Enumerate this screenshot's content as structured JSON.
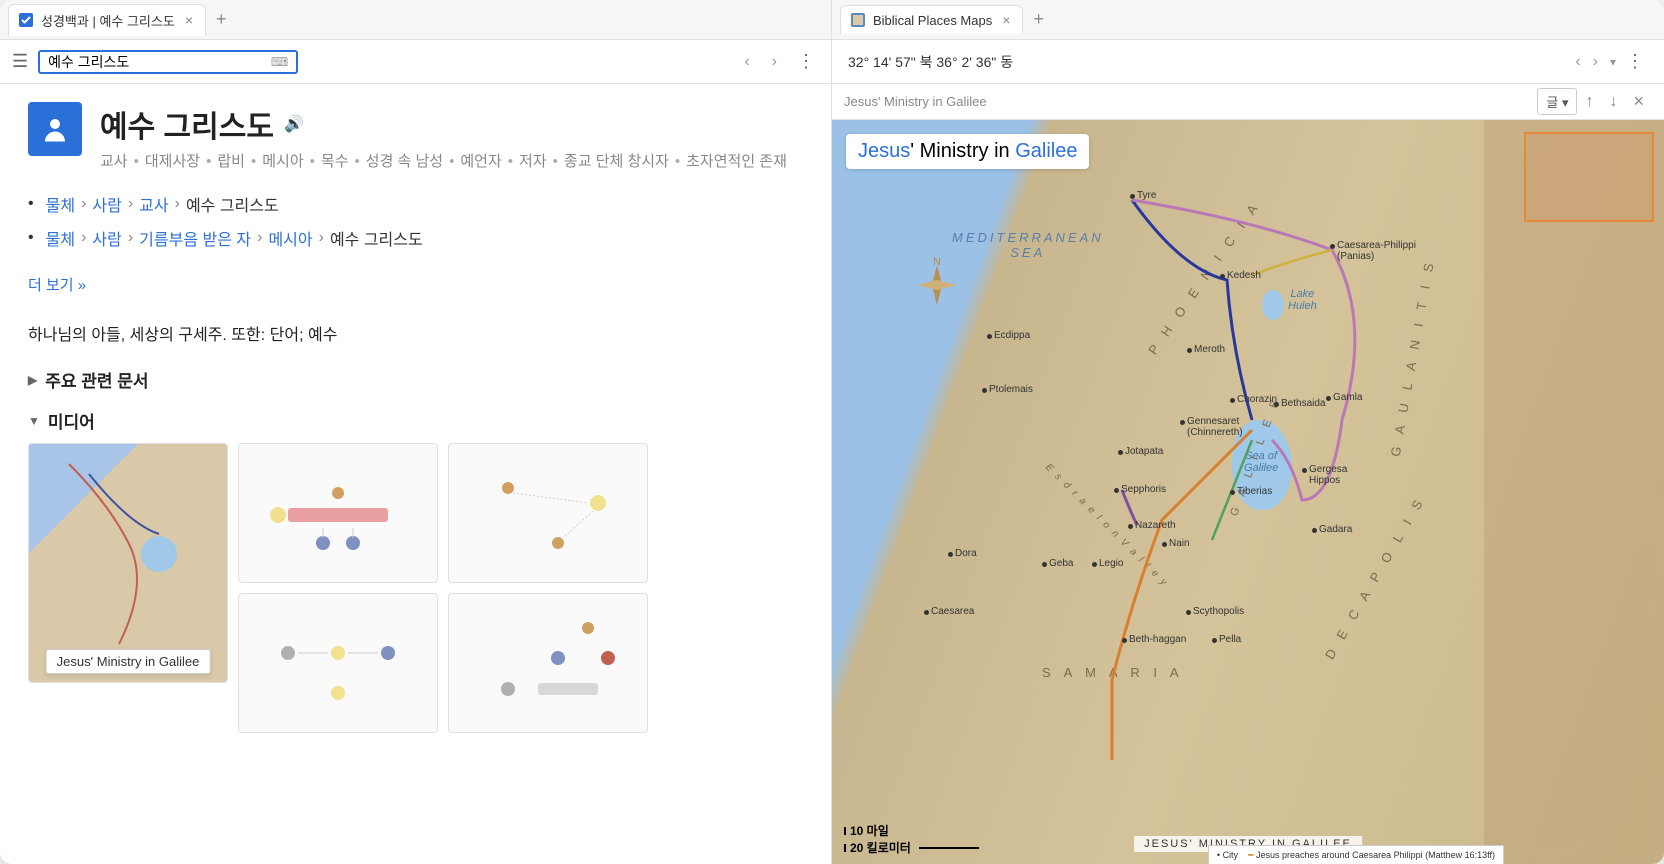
{
  "left": {
    "tab": {
      "title": "성경백과 | 예수 그리스도"
    },
    "search": {
      "value": "예수 그리스도"
    },
    "entry": {
      "title": "예수 그리스도",
      "tags": [
        "교사",
        "대제사장",
        "랍비",
        "메시아",
        "목수",
        "성경 속 남성",
        "예언자",
        "저자",
        "종교 단체 창시자",
        "초자연적인 존재"
      ],
      "breadcrumbs": [
        {
          "chain": [
            {
              "t": "물체",
              "l": true
            },
            {
              "t": "사람",
              "l": true
            },
            {
              "t": "교사",
              "l": true
            },
            {
              "t": "예수 그리스도",
              "l": false
            }
          ]
        },
        {
          "chain": [
            {
              "t": "물체",
              "l": true
            },
            {
              "t": "사람",
              "l": true
            },
            {
              "t": "기름부음 받은 자",
              "l": true
            },
            {
              "t": "메시아",
              "l": true
            },
            {
              "t": "예수 그리스도",
              "l": false
            }
          ]
        }
      ],
      "see_more": "더 보기 »",
      "summary": "하나님의 아들, 세상의 구세주. 또한: 단어; 예수",
      "sections": {
        "related": "주요 관련 문서",
        "media": "미디어"
      },
      "tooltip": "Jesus' Ministry in Galilee"
    }
  },
  "right": {
    "tab": {
      "title": "Biblical Places Maps"
    },
    "coords": "32° 14' 57\" 북 36° 2' 36\" 동",
    "header": {
      "breadcrumb": "Jesus' Ministry in Galilee",
      "lang": "글"
    },
    "map": {
      "title_parts": {
        "jesus": "Jesus",
        "mid": "' Ministry in ",
        "galilee": "Galilee"
      },
      "sea_label": "MEDITERRANEAN\nSEA",
      "compass_n": "N",
      "regions": {
        "phoenicia": "P H O E N I C I A",
        "gaulanitis": "G A U L A N I T I S",
        "samaria": "S A M A R I A",
        "decapolis": "D E C A P O L I S",
        "galilee": "G A L I L E E",
        "esdraelon": "E s d r a e l o n   V a l l e y"
      },
      "lake_galilee": "Sea of\nGalilee",
      "lake_huleh": "Lake\nHuleh",
      "cities": {
        "tyre": "Tyre",
        "kedesh": "Kedesh",
        "caesarea_philippi": "Caesarea-Philippi\n(Panias)",
        "ecdippa": "Ecdippa",
        "meroth": "Meroth",
        "ptolemais": "Ptolemais",
        "chorazin": "Chorazin",
        "bethsaida": "Bethsaida",
        "gamla": "Gamla",
        "gennesaret": "Gennesaret\n(Chinnereth)",
        "jotapata": "Jotapata",
        "sepphoris": "Sepphoris",
        "tiberias": "Tiberias",
        "gergesa": "Gergesa\nHippos",
        "nazareth": "Nazareth",
        "nain": "Nain",
        "gadara": "Gadara",
        "dora": "Dora",
        "legio": "Legio",
        "geba": "Geba",
        "caesarea": "Caesarea",
        "scythopolis": "Scythopolis",
        "pella": "Pella",
        "beth_haggan": "Beth-haggan"
      },
      "scale": {
        "miles": "10 마일",
        "km": "20 킬로미터"
      },
      "footer_title": "JESUS' MINISTRY IN GALILEE",
      "footer_legend_city": "City",
      "footer_legend_note": "Jesus preaches around Caesarea Philippi (Matthew 16:13ff)"
    }
  }
}
